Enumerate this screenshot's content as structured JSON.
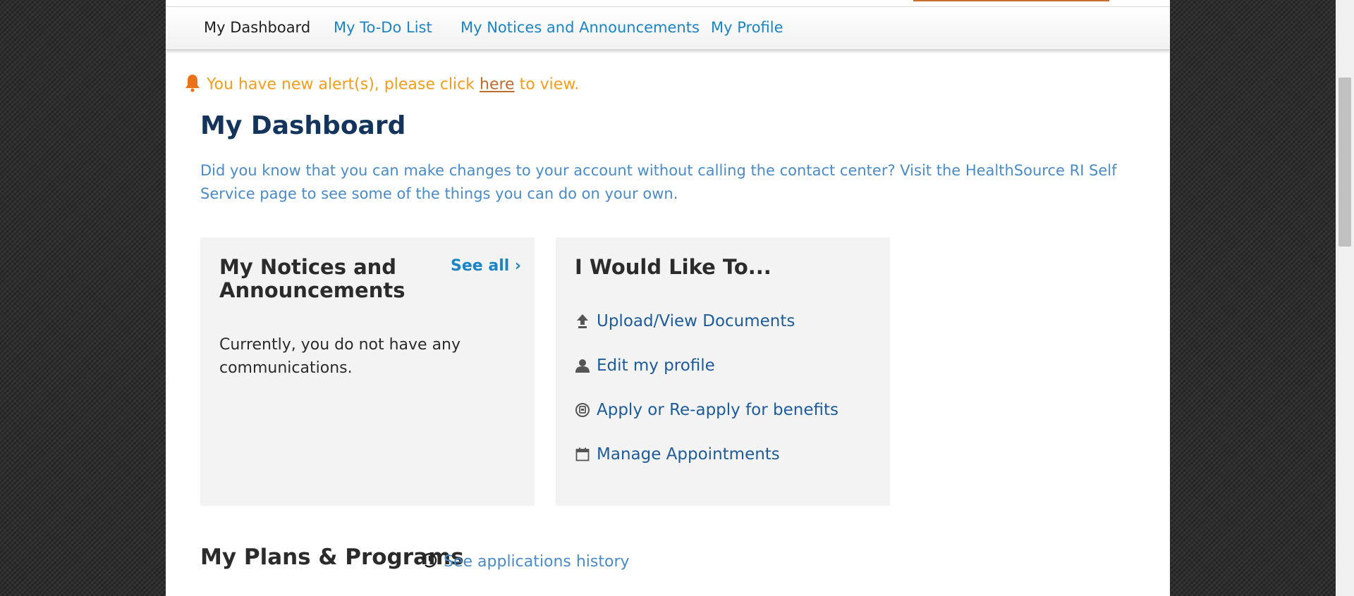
{
  "nav": {
    "items": [
      {
        "label": "My Dashboard",
        "active": true
      },
      {
        "label": "My To-Do List",
        "active": false
      },
      {
        "label": "My Notices and Announcements",
        "active": false
      },
      {
        "label": "My Profile",
        "active": false
      }
    ]
  },
  "alert": {
    "prefix": "You have new alert(s), please click ",
    "link": "here",
    "suffix": " to view.",
    "icon": "bell-icon"
  },
  "dashboard": {
    "title": "My Dashboard",
    "intro": "Did you know that you can make changes to your account without calling the contact center? Visit the HealthSource RI Self Service page to see some of the things you can do on your own."
  },
  "notices": {
    "title": "My Notices and Announcements",
    "see_all": "See all ›",
    "empty_text": "Currently, you do not have any communications."
  },
  "actions": {
    "title": "I Would Like To...",
    "items": [
      {
        "label": "Upload/View Documents",
        "icon": "upload-icon"
      },
      {
        "label": "Edit my profile",
        "icon": "user-icon"
      },
      {
        "label": "Apply or Re-apply for benefits",
        "icon": "benefits-icon"
      },
      {
        "label": "Manage Appointments",
        "icon": "calendar-icon"
      }
    ]
  },
  "plans": {
    "title": "My Plans & Programs",
    "history_link": "See applications history",
    "history_icon": "history-icon"
  },
  "colors": {
    "link": "#1b84c4",
    "title": "#14345c",
    "alert": "#f29d1e",
    "action_link": "#1e5b99"
  }
}
